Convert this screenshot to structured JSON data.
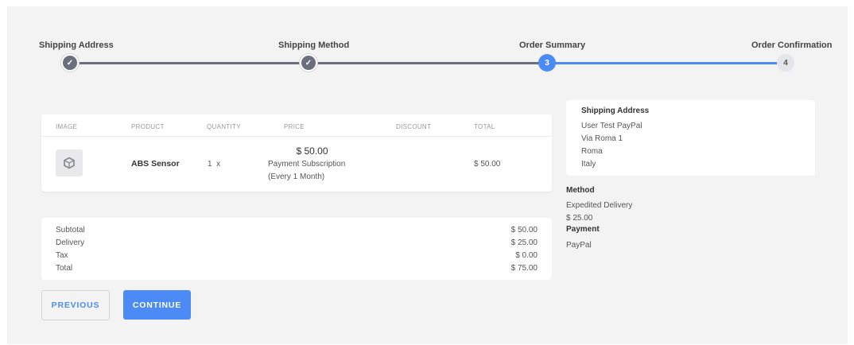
{
  "stepper": {
    "steps": [
      {
        "label": "Shipping Address",
        "state": "done",
        "marker": "✓"
      },
      {
        "label": "Shipping Method",
        "state": "done",
        "marker": "✓"
      },
      {
        "label": "Order Summary",
        "state": "active",
        "marker": "3"
      },
      {
        "label": "Order Confirmation",
        "state": "pending",
        "marker": "4"
      }
    ]
  },
  "table": {
    "headers": [
      "IMAGE",
      "PRODUCT",
      "QUANTITY",
      "PRICE",
      "DISCOUNT",
      "TOTAL"
    ],
    "row": {
      "product": "ABS Sensor",
      "quantity": "1  x",
      "price": "$ 50.00",
      "price_note_1": "Payment Subscription",
      "price_note_2": "(Every 1 Month)",
      "discount": "",
      "total": "$ 50.00",
      "image_icon": "cube-icon"
    }
  },
  "totals": {
    "subtotal_label": "Subtotal",
    "subtotal_value": "$ 50.00",
    "delivery_label": "Delivery",
    "delivery_value": "$ 25.00",
    "tax_label": "Tax",
    "tax_value": "$ 0.00",
    "total_label": "Total",
    "total_value": "$ 75.00"
  },
  "shipping": {
    "heading": "Shipping Address",
    "name": "User Test PayPal",
    "street": "Via Roma 1",
    "city": "Roma",
    "country": "Italy"
  },
  "method": {
    "heading": "Method",
    "name": "Expedited Delivery",
    "price": "$ 25.00"
  },
  "payment": {
    "heading": "Payment",
    "name": "PayPal"
  },
  "buttons": {
    "previous": "PREVIOUS",
    "continue": "CONTINUE"
  },
  "colors": {
    "accent": "#4c8bf5",
    "done": "#6b6e7d",
    "pending": "#e4e5e8",
    "background": "#f3f3f4"
  }
}
